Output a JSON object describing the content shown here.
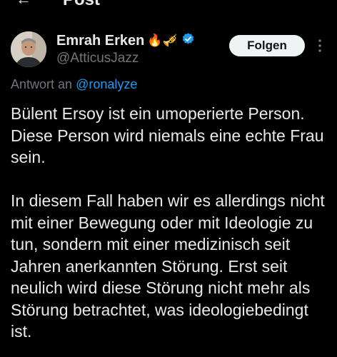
{
  "header": {
    "back_icon": "arrow-left-icon",
    "title": "Post"
  },
  "author": {
    "display_name": "Emrah Erken",
    "emojis": "🔥🎺",
    "verified_icon": "verified-badge-icon",
    "handle": "@AtticusJazz"
  },
  "actions": {
    "follow_label": "Folgen",
    "more_icon": "more-vertical-icon"
  },
  "reply_context": {
    "prefix": "Antwort an",
    "mention": "@ronalyze"
  },
  "tweet": {
    "paragraphs": [
      "Bülent Ersoy ist ein umoperierte Person. Diese Person wird niemals eine echte Frau sein.",
      "In diesem Fall haben wir es allerdings nicht mit einer Bewegung oder mit Ideologie zu tun, sondern mit einer medizinisch seit Jahren anerkannten Störung. Erst seit neulich wird diese Störung nicht mehr als Störung betrachtet, was ideologiebedingt ist."
    ]
  },
  "colors": {
    "background": "#000000",
    "text_primary": "#e7e9ea",
    "text_secondary": "#71767b",
    "accent": "#1d9bf0",
    "follow_bg": "#eff3f4"
  }
}
